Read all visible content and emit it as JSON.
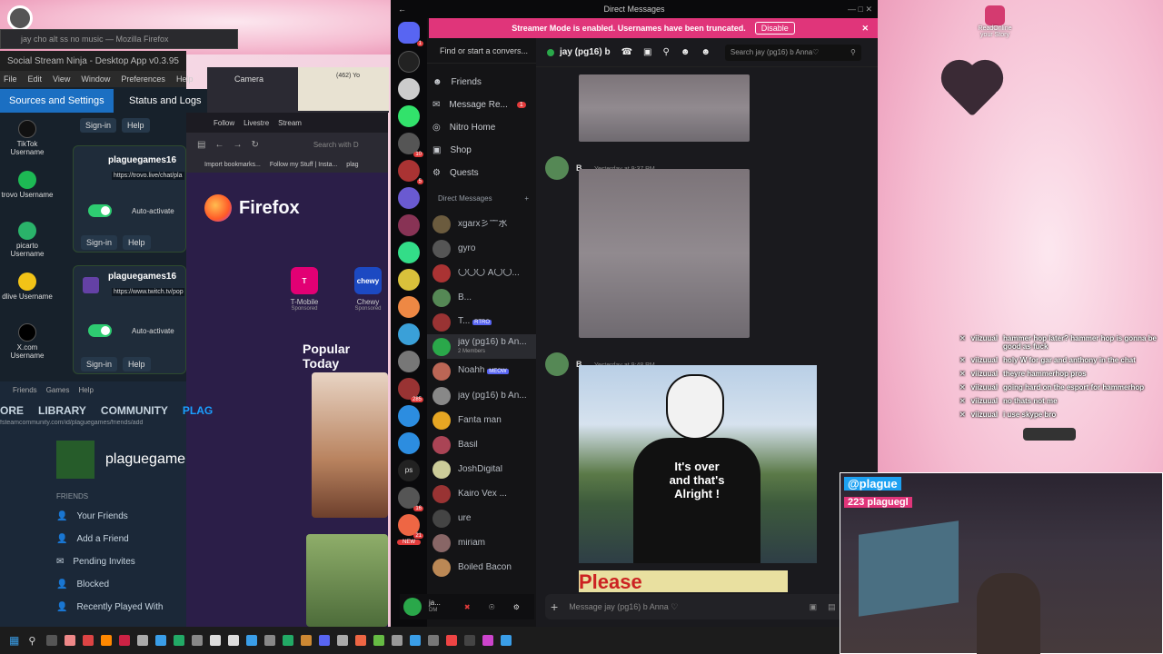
{
  "ssn_window": {
    "title": "Social Stream Ninja - Desktop App v0.3.95",
    "menu": [
      "File",
      "Edit",
      "View",
      "Window",
      "Preferences",
      "Help"
    ],
    "tabs": [
      "Sources and Settings",
      "Status and Logs"
    ],
    "services": [
      {
        "name": "TikTok Username",
        "color": "#111111"
      },
      {
        "name": "trovo Username",
        "color": "#1db954"
      },
      {
        "name": "picarto Username",
        "color": "#2ab36a"
      },
      {
        "name": "dlive Username",
        "color": "#f2c317"
      },
      {
        "name": "X.com Username",
        "color": "#000000"
      }
    ],
    "cards": [
      {
        "name": "plaguegames16",
        "url": "https://trovo.live/chat/pla",
        "auto": "Auto-activate"
      },
      {
        "name": "plaguegames16",
        "url": "https://www.twitch.tv/pop",
        "auto": "Auto-activate"
      }
    ],
    "sign_in": "Sign-in",
    "help": "Help"
  },
  "ff_title": "jay cho alt ss no music — Mozilla Firefox",
  "firefox": {
    "tabs": [
      "Follow",
      "Livestre",
      "Stream"
    ],
    "bookmarks": [
      "Import bookmarks...",
      "Follow my Stuff | Insta...",
      "plag"
    ],
    "search_placeholder": "Search with D",
    "brand": "Firefox",
    "shortcuts": [
      {
        "name": "T-Mobile",
        "sub": "Sponsored",
        "letter": "T",
        "color": "#e20074"
      },
      {
        "name": "Chewy",
        "sub": "Sponsored",
        "letter": "chewy",
        "color": "#1c49c2"
      }
    ],
    "popular": "Popular Today"
  },
  "camera": {
    "label": "Camera",
    "badge": "(462) Yo"
  },
  "steam": {
    "menu": [
      "Friends",
      "Games",
      "Help"
    ],
    "nav": [
      "ORE",
      "LIBRARY",
      "COMMUNITY",
      "PLAG"
    ],
    "url": "fsteamcommunity.com/id/plaguegames/friends/add",
    "username": "plaguegame",
    "friends_header": "FRIENDS",
    "friends": [
      "Your Friends",
      "Add a Friend",
      "Pending Invites",
      "Blocked",
      "Recently Played With"
    ]
  },
  "discord": {
    "title": "Direct Messages",
    "banner": "Streamer Mode is enabled. Usernames have been truncated.",
    "disable": "Disable",
    "search_dm": "Find or start a convers...",
    "channel": "jay (pg16) b",
    "search_channel": "Search jay (pg16) b Anna♡",
    "nav": [
      {
        "label": "Friends",
        "badge": ""
      },
      {
        "label": "Message Re...",
        "badge": "1"
      },
      {
        "label": "Nitro Home",
        "badge": ""
      },
      {
        "label": "Shop",
        "badge": ""
      },
      {
        "label": "Quests",
        "badge": ""
      }
    ],
    "dm_header": "Direct Messages",
    "dms": [
      {
        "name": "xgarx彡亠水",
        "sub": "",
        "tag": "",
        "color": "#6b5b3e"
      },
      {
        "name": "gyro",
        "sub": "",
        "tag": "",
        "color": "#555"
      },
      {
        "name": "〇〇〇 A〇〇...",
        "sub": "",
        "tag": "",
        "color": "#a33"
      },
      {
        "name": "B...",
        "sub": "",
        "tag": "",
        "color": "#585"
      },
      {
        "name": "T...",
        "sub": "",
        "tag": "RTRO",
        "color": "#933"
      },
      {
        "name": "jay (pg16) b An...",
        "sub": "2 Members",
        "tag": "",
        "color": "#2aa84a"
      },
      {
        "name": "Noahh",
        "sub": "",
        "tag": "MEOW",
        "color": "#b65"
      },
      {
        "name": "jay (pg16) b An...",
        "sub": "",
        "tag": "",
        "color": "#888"
      },
      {
        "name": "Fanta man",
        "sub": "",
        "tag": "",
        "color": "#e6a623"
      },
      {
        "name": "Basil",
        "sub": "",
        "tag": "",
        "color": "#a45"
      },
      {
        "name": "JoshDigital",
        "sub": "",
        "tag": "",
        "color": "#cc9"
      },
      {
        "name": "Kairo Vex ...",
        "sub": "",
        "tag": "",
        "color": "#933"
      },
      {
        "name": "ure",
        "sub": "",
        "tag": "",
        "color": "#444"
      },
      {
        "name": "miriam",
        "sub": "",
        "tag": "",
        "color": "#866"
      },
      {
        "name": "Boiled Bacon",
        "sub": "",
        "tag": "",
        "color": "#b85"
      }
    ],
    "user_short": "ja...",
    "user_status": "DM",
    "messages": [
      {
        "author": "B...",
        "time": "Yesterday at 9:37 PM"
      },
      {
        "author": "B...",
        "time": "Yesterday at 9:48 PM"
      }
    ],
    "meme_text": "It's over and that's Alright !",
    "meme_partial": "Please",
    "input_placeholder": "Message jay (pg16) b Anna ♡",
    "new_badge": "NEW"
  },
  "overlay_chat": [
    {
      "user": "viizuual",
      "text": "hammer hop later? hammer hop is gonna be good as fuck"
    },
    {
      "user": "viizuual",
      "text": "holy W for gar and anthony in the chat"
    },
    {
      "user": "viizuual",
      "text": "theyre hammerhop pros"
    },
    {
      "user": "viizuual",
      "text": "going hard on the esport for hammerhop"
    },
    {
      "user": "viizuual",
      "text": "no thats not me"
    },
    {
      "user": "viizuual",
      "text": "i use skype bro"
    }
  ],
  "cam_overlay": {
    "handle": "@plague",
    "line2": "223 plaguegl"
  },
  "desktop_icon": "ReadOnline your Story"
}
